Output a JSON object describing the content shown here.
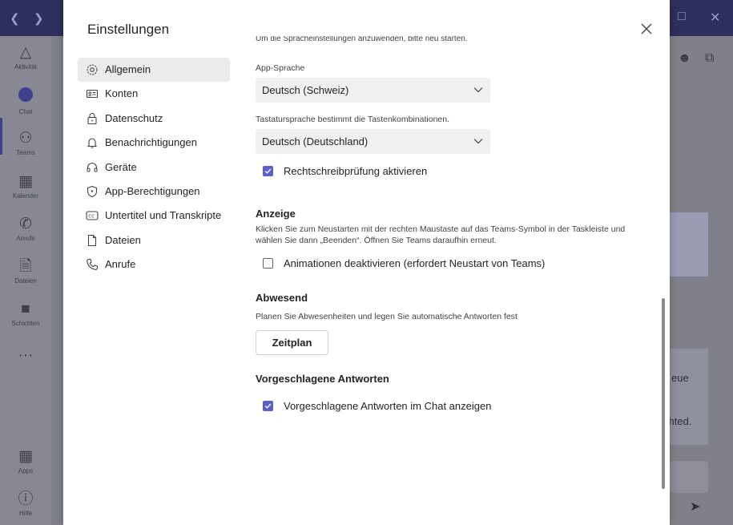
{
  "background": {
    "rail": [
      {
        "label": "Aktivität",
        "icon": "bell-icon"
      },
      {
        "label": "Chat",
        "icon": "chat-icon"
      },
      {
        "label": "Teams",
        "icon": "teams-icon"
      },
      {
        "label": "Kalender",
        "icon": "calendar-icon"
      },
      {
        "label": "Anrufe",
        "icon": "phone-icon"
      },
      {
        "label": "Dateien",
        "icon": "file-icon"
      },
      {
        "label": "Schichten",
        "icon": "shifts-icon"
      },
      {
        "label": "Apps",
        "icon": "apps-icon"
      },
      {
        "label": "Hilfe",
        "icon": "help-icon"
      }
    ],
    "more_label": "···",
    "snippet_1": "eue",
    "snippet_2": "chted."
  },
  "dialog": {
    "title": "Einstellungen",
    "nav": [
      {
        "label": "Allgemein",
        "icon": "gear-icon",
        "active": true
      },
      {
        "label": "Konten",
        "icon": "id-card-icon"
      },
      {
        "label": "Datenschutz",
        "icon": "lock-icon"
      },
      {
        "label": "Benachrichtigungen",
        "icon": "bell-icon"
      },
      {
        "label": "Geräte",
        "icon": "headset-icon"
      },
      {
        "label": "App-Berechtigungen",
        "icon": "shield-icon"
      },
      {
        "label": "Untertitel und Transkripte",
        "icon": "cc-icon"
      },
      {
        "label": "Dateien",
        "icon": "file-icon"
      },
      {
        "label": "Anrufe",
        "icon": "phone-icon"
      }
    ],
    "content": {
      "clipped_text": "Um die Spracheinstellungen anzuwenden, bitte neu starten.",
      "app_language_label": "App-Sprache",
      "app_language_value": "Deutsch (Schweiz)",
      "keyboard_language_label": "Tastatursprache bestimmt die Tastenkombinationen.",
      "keyboard_language_value": "Deutsch (Deutschland)",
      "spellcheck_label": "Rechtschreibprüfung aktivieren",
      "spellcheck_checked": true,
      "display_title": "Anzeige",
      "display_desc": "Klicken Sie zum Neustarten mit der rechten Maustaste auf das Teams-Symbol in der Taskleiste und wählen Sie dann „Beenden“. Öffnen Sie Teams daraufhin erneut.",
      "animations_label": "Animationen deaktivieren (erfordert Neustart von Teams)",
      "animations_checked": false,
      "away_title": "Abwesend",
      "away_desc": "Planen Sie Abwesenheiten und legen Sie automatische Antworten fest",
      "schedule_button": "Zeitplan",
      "suggested_title": "Vorgeschlagene Antworten",
      "suggested_label": "Vorgeschlagene Antworten im Chat anzeigen",
      "suggested_checked": true
    }
  },
  "colors": {
    "accent": "#5b5fc7",
    "titlebar": "#2e2f5e",
    "nav_active": "#ebebeb"
  }
}
